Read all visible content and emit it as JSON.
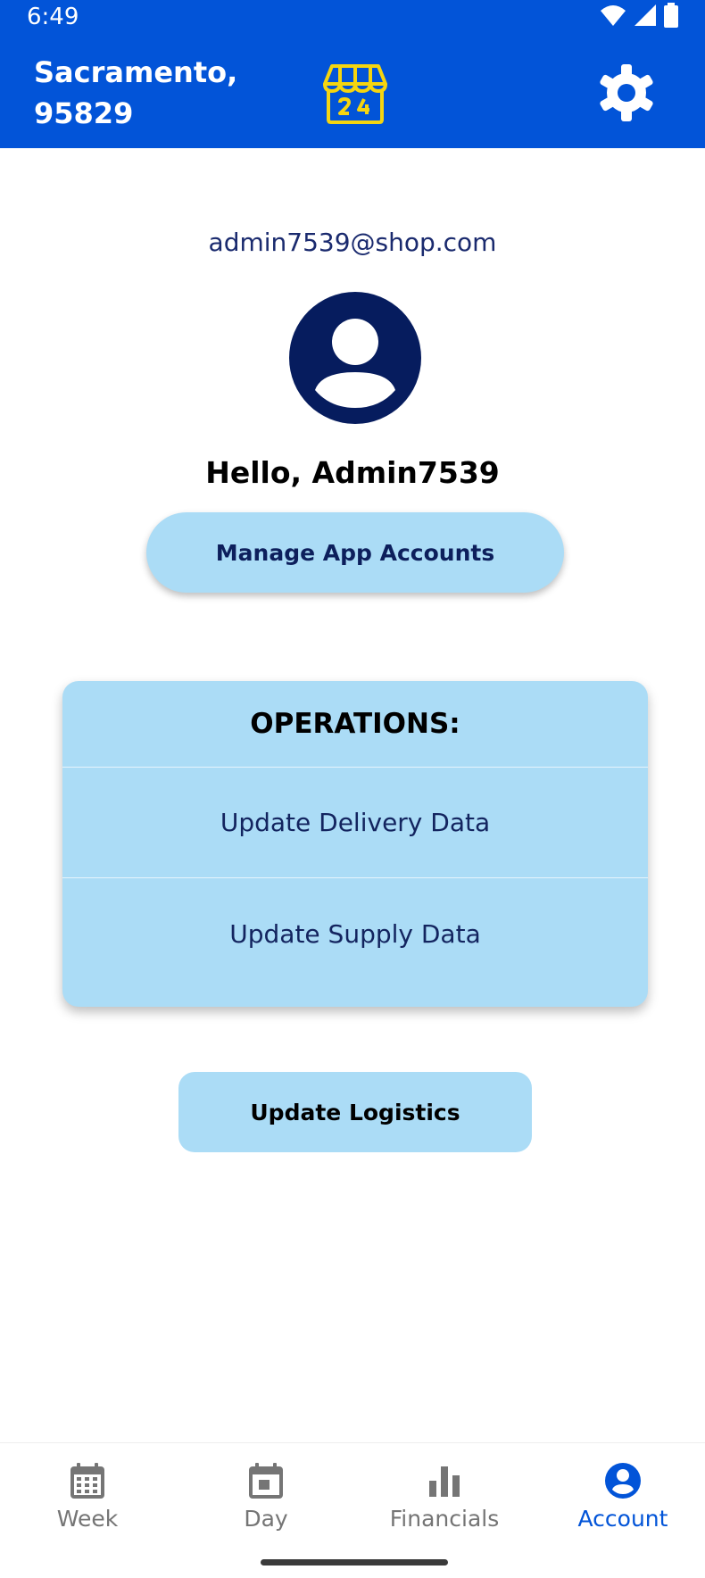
{
  "status_bar": {
    "time": "6:49",
    "icons": [
      "wifi-icon",
      "signal-icon",
      "battery-icon"
    ]
  },
  "header": {
    "location_line1": "Sacramento,",
    "location_line2": "95829",
    "store_icon": "store-24h-icon",
    "settings_icon": "gear-icon"
  },
  "profile": {
    "email": "admin7539@shop.com",
    "avatar_icon": "account-circle-icon",
    "greeting": "Hello, Admin7539"
  },
  "manage_button": {
    "label": "Manage App Accounts"
  },
  "operations": {
    "title": "OPERATIONS:",
    "items": [
      {
        "label": "Update Delivery Data"
      },
      {
        "label": "Update Supply Data"
      }
    ]
  },
  "logistics_button": {
    "label": "Update Logistics"
  },
  "bottom_nav": {
    "items": [
      {
        "label": "Week",
        "icon": "calendar-grid-icon"
      },
      {
        "label": "Day",
        "icon": "calendar-day-icon"
      },
      {
        "label": "Financials",
        "icon": "bar-chart-icon"
      },
      {
        "label": "Account",
        "icon": "account-circle-icon"
      }
    ],
    "active": "Account"
  },
  "colors": {
    "header_bg": "#0254d8",
    "accent_yellow": "#f5d50f",
    "card_bg": "#abdcf6",
    "navy": "#061c5e",
    "active_nav": "#0254d8",
    "inactive_nav": "#757575"
  }
}
